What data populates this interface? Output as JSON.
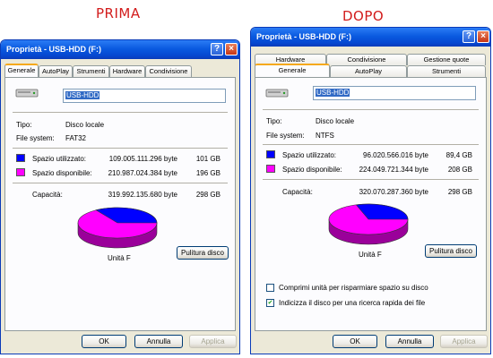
{
  "captions": {
    "before": "PRIMA",
    "after": "DOPO"
  },
  "window_title": "Proprietà - USB-HDD (F:)",
  "title_buttons": {
    "help": "?",
    "close": "×"
  },
  "before": {
    "tabs": [
      "Generale",
      "AutoPlay",
      "Strumenti",
      "Hardware",
      "Condivisione"
    ],
    "active_tab": "Generale",
    "name_field": "USB-HDD",
    "type_label": "Tipo:",
    "type_value": "Disco locale",
    "fs_label": "File system:",
    "fs_value": "FAT32",
    "used_label": "Spazio utilizzato:",
    "used_bytes": "109.005.111.296 byte",
    "used_gb": "101 GB",
    "free_label": "Spazio disponibile:",
    "free_bytes": "210.987.024.384 byte",
    "free_gb": "196 GB",
    "capacity_label": "Capacità:",
    "capacity_bytes": "319.992.135.680 byte",
    "capacity_gb": "298 GB",
    "used_fraction": 0.341,
    "drive_label": "Unità F",
    "cleanup_button": "Pulitura disco",
    "buttons": {
      "ok": "OK",
      "cancel": "Annulla",
      "apply": "Applica"
    }
  },
  "after": {
    "tabs_top": [
      "Hardware",
      "Condivisione",
      "Gestione quote"
    ],
    "tabs_bottom": [
      "Generale",
      "AutoPlay",
      "Strumenti"
    ],
    "active_tab": "Generale",
    "name_field": "USB-HDD",
    "type_label": "Tipo:",
    "type_value": "Disco locale",
    "fs_label": "File system:",
    "fs_value": "NTFS",
    "used_label": "Spazio utilizzato:",
    "used_bytes": "96.020.566.016 byte",
    "used_gb": "89,4 GB",
    "free_label": "Spazio disponibile:",
    "free_bytes": "224.049.721.344 byte",
    "free_gb": "208 GB",
    "capacity_label": "Capacità:",
    "capacity_bytes": "320.070.287.360 byte",
    "capacity_gb": "298 GB",
    "used_fraction": 0.3,
    "drive_label": "Unità F",
    "cleanup_button": "Pulitura disco",
    "compress_label": "Comprimi unità per risparmiare spazio su disco",
    "compress_checked": false,
    "index_label": "Indicizza il disco per una ricerca rapida dei file",
    "index_checked": true,
    "buttons": {
      "ok": "OK",
      "cancel": "Annulla",
      "apply": "Applica"
    }
  },
  "colors": {
    "used": "#0000ff",
    "free": "#ff00ff",
    "title_bar": "#0a5ae0",
    "caption": "#d21c1c"
  }
}
